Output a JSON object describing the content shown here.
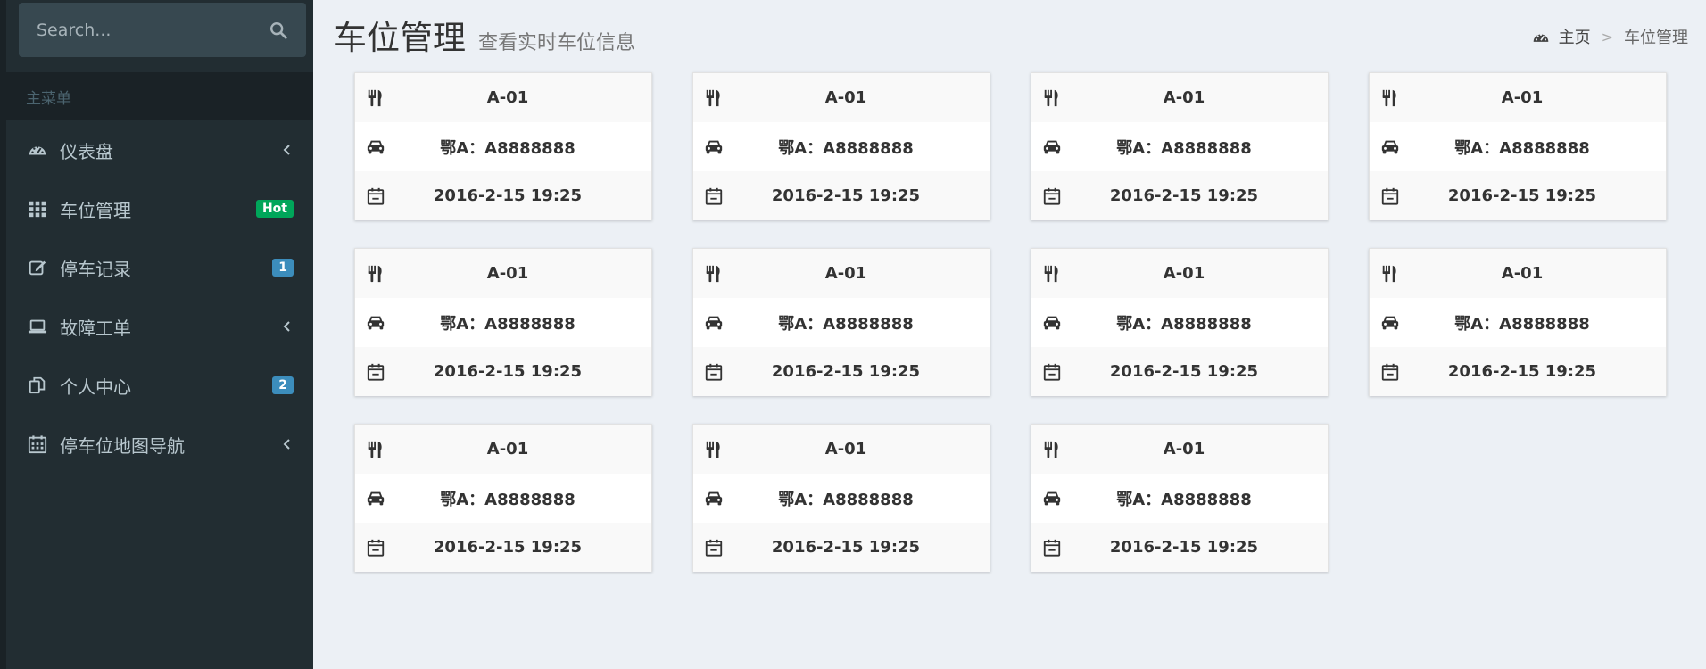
{
  "search": {
    "placeholder": "Search..."
  },
  "sidebar": {
    "header": "主菜单",
    "items": [
      {
        "label": "仪表盘"
      },
      {
        "label": "车位管理",
        "badge": "Hot"
      },
      {
        "label": "停车记录",
        "badge": "1"
      },
      {
        "label": "故障工单"
      },
      {
        "label": "个人中心",
        "badge": "2"
      },
      {
        "label": "停车位地图导航"
      }
    ]
  },
  "header": {
    "title": "车位管理",
    "subtitle": "查看实时车位信息"
  },
  "breadcrumb": {
    "home": "主页",
    "separator": ">",
    "current": "车位管理"
  },
  "cards": [
    {
      "space": "A-01",
      "plate": "鄂A：A8888888",
      "time": "2016-2-15 19:25"
    },
    {
      "space": "A-01",
      "plate": "鄂A：A8888888",
      "time": "2016-2-15 19:25"
    },
    {
      "space": "A-01",
      "plate": "鄂A：A8888888",
      "time": "2016-2-15 19:25"
    },
    {
      "space": "A-01",
      "plate": "鄂A：A8888888",
      "time": "2016-2-15 19:25"
    },
    {
      "space": "A-01",
      "plate": "鄂A：A8888888",
      "time": "2016-2-15 19:25"
    },
    {
      "space": "A-01",
      "plate": "鄂A：A8888888",
      "time": "2016-2-15 19:25"
    },
    {
      "space": "A-01",
      "plate": "鄂A：A8888888",
      "time": "2016-2-15 19:25"
    },
    {
      "space": "A-01",
      "plate": "鄂A：A8888888",
      "time": "2016-2-15 19:25"
    },
    {
      "space": "A-01",
      "plate": "鄂A：A8888888",
      "time": "2016-2-15 19:25"
    },
    {
      "space": "A-01",
      "plate": "鄂A：A8888888",
      "time": "2016-2-15 19:25"
    },
    {
      "space": "A-01",
      "plate": "鄂A：A8888888",
      "time": "2016-2-15 19:25"
    }
  ],
  "icons": {
    "search": "search-icon",
    "menu": [
      "dashboard-icon",
      "grid-icon",
      "edit-icon",
      "laptop-icon",
      "copy-icon",
      "calendar-icon"
    ],
    "card_rows": [
      "cutlery-icon",
      "car-icon",
      "calendar-icon"
    ]
  },
  "colors": {
    "sidebar_bg": "#222d32",
    "page_bg": "#ecf0f5",
    "badge_hot": "#00a65a",
    "badge_count": "#3c8dbc"
  }
}
